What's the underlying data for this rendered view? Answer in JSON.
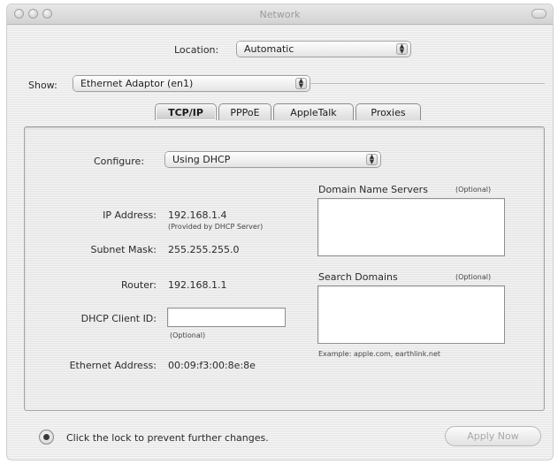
{
  "window": {
    "title": "Network"
  },
  "location": {
    "label": "Location:",
    "value": "Automatic"
  },
  "show": {
    "label": "Show:",
    "value": "Ethernet Adaptor (en1)"
  },
  "tabs": [
    {
      "label": "TCP/IP",
      "selected": true
    },
    {
      "label": "PPPoE",
      "selected": false
    },
    {
      "label": "AppleTalk",
      "selected": false
    },
    {
      "label": "Proxies",
      "selected": false
    }
  ],
  "tcpip": {
    "configure_label": "Configure:",
    "configure_value": "Using DHCP",
    "ip_label": "IP Address:",
    "ip_value": "192.168.1.4",
    "ip_note": "(Provided by DHCP Server)",
    "subnet_label": "Subnet Mask:",
    "subnet_value": "255.255.255.0",
    "router_label": "Router:",
    "router_value": "192.168.1.1",
    "dhcp_label": "DHCP Client ID:",
    "dhcp_value": "",
    "dhcp_note": "(Optional)",
    "ethernet_label": "Ethernet Address:",
    "ethernet_value": "00:09:f3:00:8e:8e",
    "dns_label": "Domain Name Servers",
    "dns_optional": "(Optional)",
    "search_label": "Search Domains",
    "search_optional": "(Optional)",
    "search_example": "Example: apple.com, earthlink.net"
  },
  "footer": {
    "lock_text": "Click the lock to prevent further changes.",
    "apply_label": "Apply Now"
  }
}
